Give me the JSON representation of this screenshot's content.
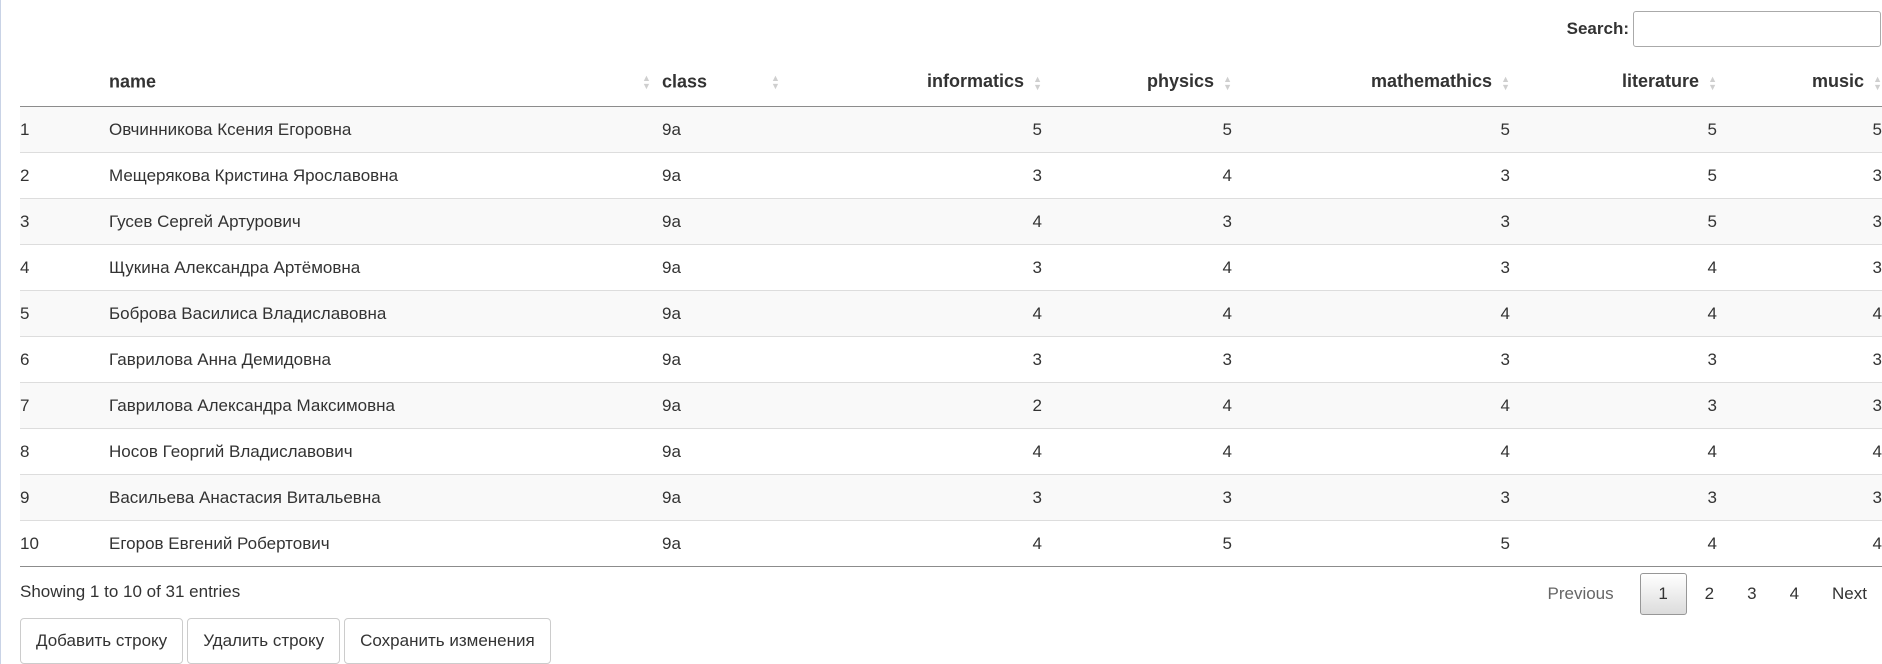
{
  "search": {
    "label": "Search:",
    "value": "",
    "placeholder": ""
  },
  "table": {
    "columns": [
      {
        "key": "idx",
        "label": ""
      },
      {
        "key": "name",
        "label": "name"
      },
      {
        "key": "class",
        "label": "class"
      },
      {
        "key": "informatics",
        "label": "informatics"
      },
      {
        "key": "physics",
        "label": "physics"
      },
      {
        "key": "mathemathics",
        "label": "mathemathics"
      },
      {
        "key": "literature",
        "label": "literature"
      },
      {
        "key": "music",
        "label": "music"
      }
    ],
    "rows": [
      {
        "idx": "1",
        "name": "Овчинникова Ксения Егоровна",
        "class": "9a",
        "informatics": "5",
        "physics": "5",
        "mathemathics": "5",
        "literature": "5",
        "music": "5"
      },
      {
        "idx": "2",
        "name": "Мещерякова Кристина Ярославовна",
        "class": "9a",
        "informatics": "3",
        "physics": "4",
        "mathemathics": "3",
        "literature": "5",
        "music": "3"
      },
      {
        "idx": "3",
        "name": "Гусев Сергей Артурович",
        "class": "9a",
        "informatics": "4",
        "physics": "3",
        "mathemathics": "3",
        "literature": "5",
        "music": "3"
      },
      {
        "idx": "4",
        "name": "Щукина Александра Артёмовна",
        "class": "9a",
        "informatics": "3",
        "physics": "4",
        "mathemathics": "3",
        "literature": "4",
        "music": "3"
      },
      {
        "idx": "5",
        "name": "Боброва Василиса Владиславовна",
        "class": "9a",
        "informatics": "4",
        "physics": "4",
        "mathemathics": "4",
        "literature": "4",
        "music": "4"
      },
      {
        "idx": "6",
        "name": "Гаврилова Анна Демидовна",
        "class": "9a",
        "informatics": "3",
        "physics": "3",
        "mathemathics": "3",
        "literature": "3",
        "music": "3"
      },
      {
        "idx": "7",
        "name": "Гаврилова Александра Максимовна",
        "class": "9a",
        "informatics": "2",
        "physics": "4",
        "mathemathics": "4",
        "literature": "3",
        "music": "3"
      },
      {
        "idx": "8",
        "name": "Носов Георгий Владиславович",
        "class": "9a",
        "informatics": "4",
        "physics": "4",
        "mathemathics": "4",
        "literature": "4",
        "music": "4"
      },
      {
        "idx": "9",
        "name": "Васильева Анастасия Витальевна",
        "class": "9a",
        "informatics": "3",
        "physics": "3",
        "mathemathics": "3",
        "literature": "3",
        "music": "3"
      },
      {
        "idx": "10",
        "name": "Егоров Евгений Робертович",
        "class": "9a",
        "informatics": "4",
        "physics": "5",
        "mathemathics": "5",
        "literature": "4",
        "music": "4"
      }
    ]
  },
  "footer": {
    "info": "Showing 1 to 10 of 31 entries"
  },
  "pagination": {
    "previous": "Previous",
    "pages": [
      "1",
      "2",
      "3",
      "4"
    ],
    "current": "1",
    "next": "Next"
  },
  "buttons": {
    "add_row": "Добавить строку",
    "delete_row": "Удалить строку",
    "save_changes": "Сохранить изменения"
  }
}
